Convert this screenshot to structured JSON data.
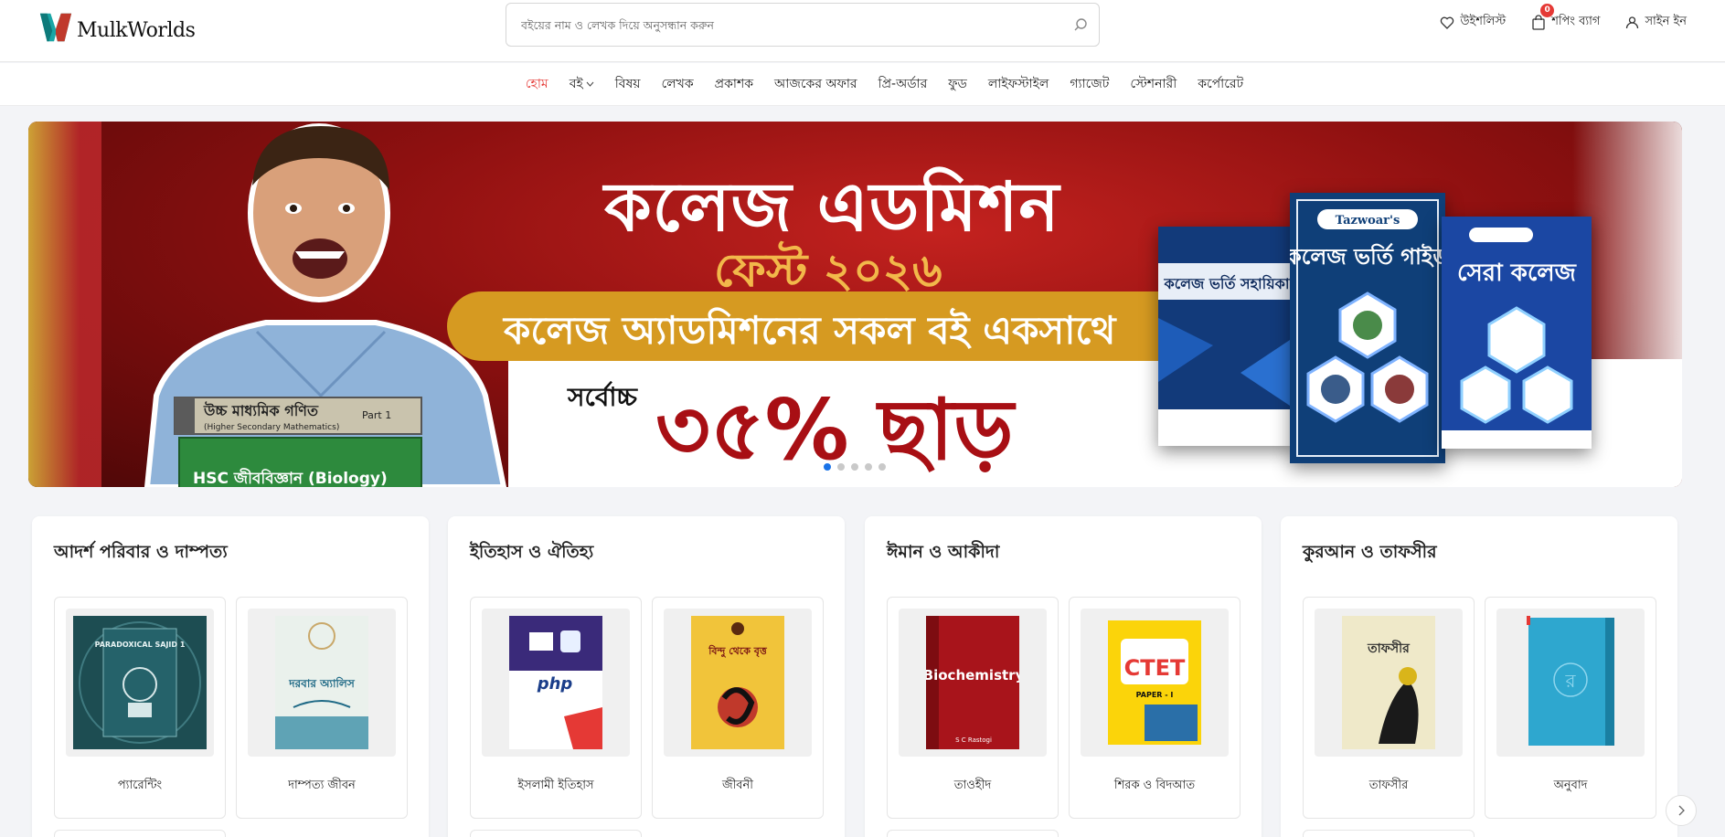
{
  "header": {
    "logo_text": "MulkWorlds",
    "search_placeholder": "বইয়ের নাম ও লেখক দিয়ে অনুসন্ধান করুন",
    "wishlist_label": "উইশলিস্ট",
    "cart_label": "শপিং ব্যাগ",
    "cart_count": "0",
    "signin_label": "সাইন ইন"
  },
  "nav": {
    "items": [
      "হোম",
      "বই",
      "বিষয়",
      "লেখক",
      "প্রকাশক",
      "আজকের অফার",
      "প্রি-অর্ডার",
      "ফুড",
      "লাইফস্টাইল",
      "গ্যাজেট",
      "স্টেশনারী",
      "কর্পোরেট"
    ]
  },
  "banner": {
    "title": "কলেজ এডমিশন",
    "subtitle": "ফেস্ট ২০২৬",
    "ribbon": "কলেজ অ্যাডমিশনের সকল বই একসাথে",
    "upto": "সর্বোচ্চ",
    "discount": "৩৫% ছাড়",
    "book1_title": "উচ্চ মাধ্যমিক গণিত",
    "book1_sub": "(Higher Secondary Mathematics)",
    "book1_part": "Part 1",
    "book2_title": "HSC জীববিজ্ঞান (Biology)",
    "cover1_title": "কলেজ ভর্তি সহায়িকা",
    "cover2_brand": "Tazwoar's",
    "cover2_title": "কলেজ ভর্তি গাইড",
    "cover3_title": "সেরা কলেজ",
    "slides": 5,
    "active_slide": 1
  },
  "categories": [
    {
      "title": "আদর্শ পরিবার ও দাম্পত্য",
      "items": [
        "প্যারেন্টিং",
        "দাম্পত্য জীবন"
      ]
    },
    {
      "title": "ইতিহাস ও ঐতিহ্য",
      "items": [
        "ইসলামী ইতিহাস",
        "জীবনী"
      ]
    },
    {
      "title": "ঈমান ও আকীদা",
      "items": [
        "তাওহীদ",
        "শিরক ও বিদআত"
      ]
    },
    {
      "title": "কুরআন ও তাফসীর",
      "items": [
        "তাফসীর",
        "অনুবাদ"
      ]
    }
  ],
  "covers": {
    "paradox_title": "PARADOXICAL SAJID 1",
    "dorbar_title": "দরবার অ্যালিস",
    "php_title": "php",
    "bidrohi_title": "বিন্দু থেকে বৃত্ত",
    "biochem_title": "Biochemistry",
    "biochem_author": "S C Rastogi",
    "ctet_title": "CTET",
    "ctet_sub": "PAPER - I",
    "tafsir_title": "তাফসীর",
    "anubad_letter": "র"
  },
  "colors": {
    "accent_red": "#e53935",
    "active_dot": "#1a73e8",
    "ribbon_gold": "#d69a21"
  }
}
